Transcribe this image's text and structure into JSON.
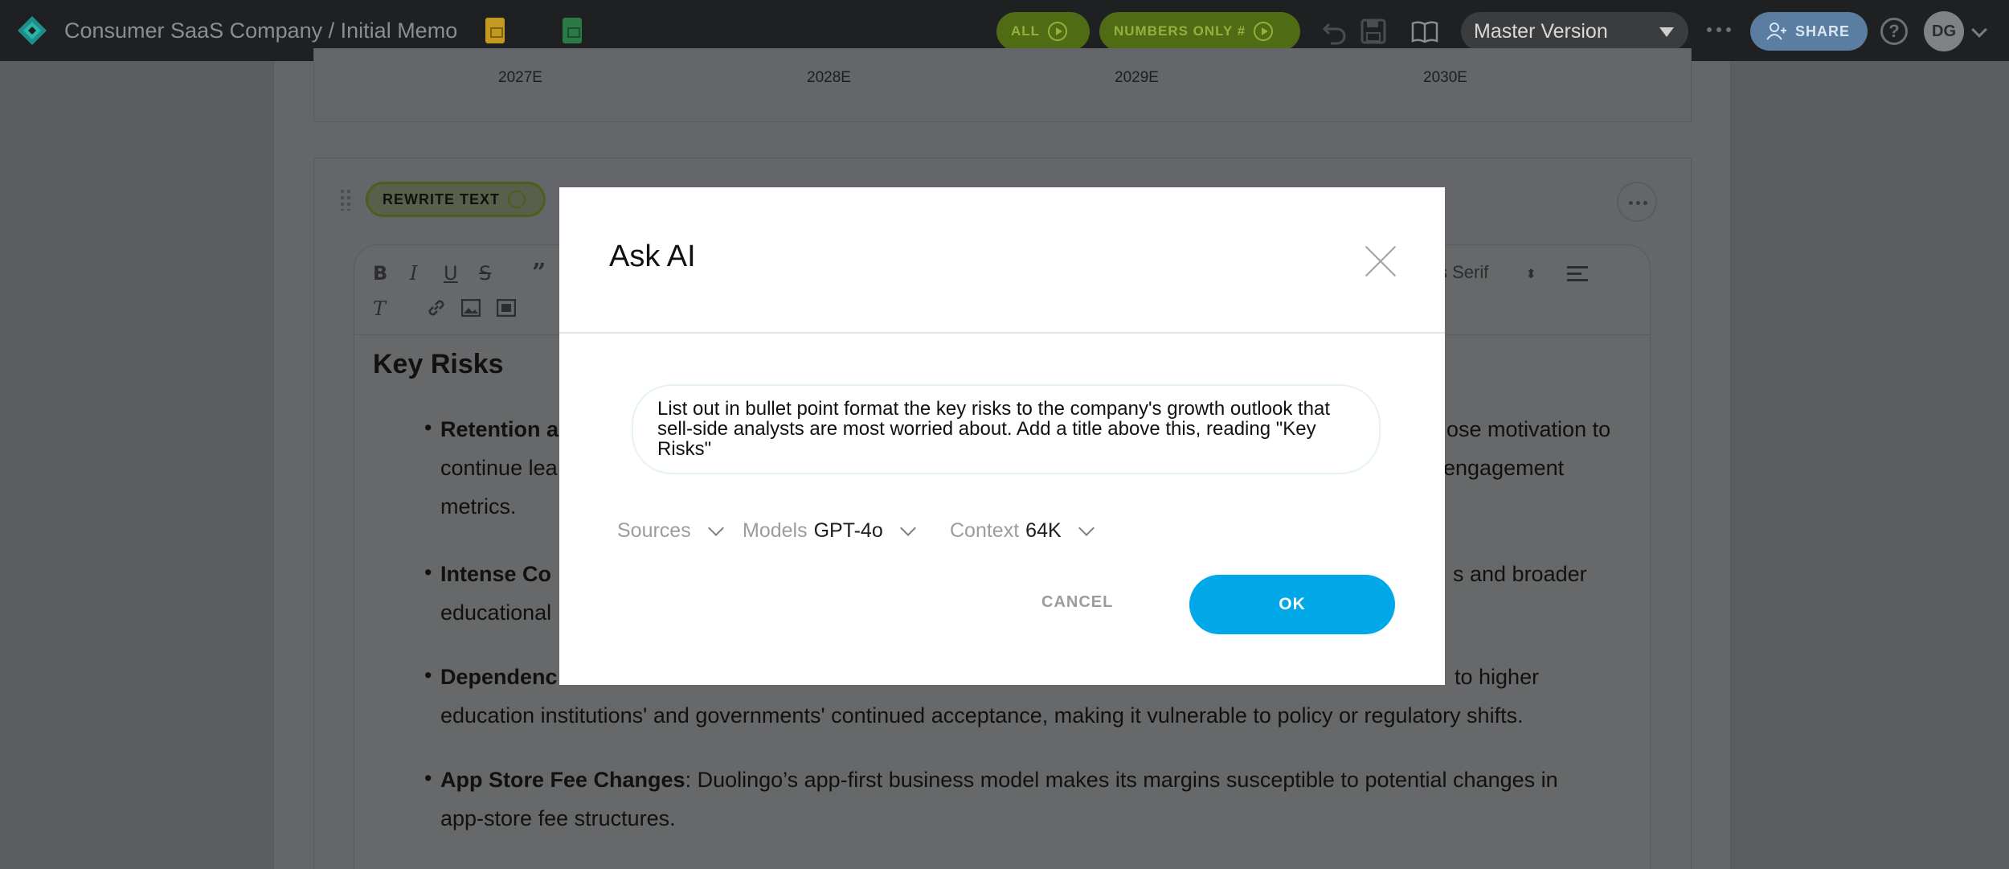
{
  "app": {
    "title": "Consumer SaaS Company / Initial Memo",
    "icons": [
      "logo-icon",
      "slides-icon",
      "sheets-icon"
    ]
  },
  "toolbar": {
    "all_label": "ALL",
    "numbers_label": "NUMBERS ONLY #",
    "version_label": "Master Version",
    "share_label": "SHARE",
    "help_label": "?",
    "avatar_initials": "DG",
    "accent_green": "#4f6b13",
    "accent_blue": "#00a8e8"
  },
  "document": {
    "chart_axis": [
      "2027E",
      "2028E",
      "2029E",
      "2030E"
    ],
    "rewrite_label": "REWRITE TEXT",
    "font_label": "s Serif",
    "heading": "Key Risks",
    "bullets": [
      {
        "bold": "Retention a",
        "line1_tail": "ose motivation to",
        "line2": "continue lea",
        "line2_tail": "engagement",
        "line3": "metrics."
      },
      {
        "bold": "Intense Co",
        "line1_tail": "s and broader",
        "line2": "educational"
      },
      {
        "bold": "Dependenc",
        "line1_tail": "to higher",
        "line2": "education institutions' and governments' continued acceptance, making it vulnerable to policy or regulatory shifts."
      },
      {
        "bold": "App Store Fee Changes",
        "rest": ": Duolingo’s app-first business model makes its margins susceptible to potential changes in",
        "line2": "app-store fee structures."
      }
    ]
  },
  "modal": {
    "title": "Ask AI",
    "prompt": "List out in bullet point format the key risks to the company's growth outlook that sell-side analysts are most worried about. Add a title above this, reading \"Key Risks\"",
    "sources_label": "Sources",
    "models_label": "Models",
    "models_value": "GPT-4o",
    "context_label": "Context",
    "context_value": "64K",
    "cancel_label": "CANCEL",
    "ok_label": "OK"
  }
}
